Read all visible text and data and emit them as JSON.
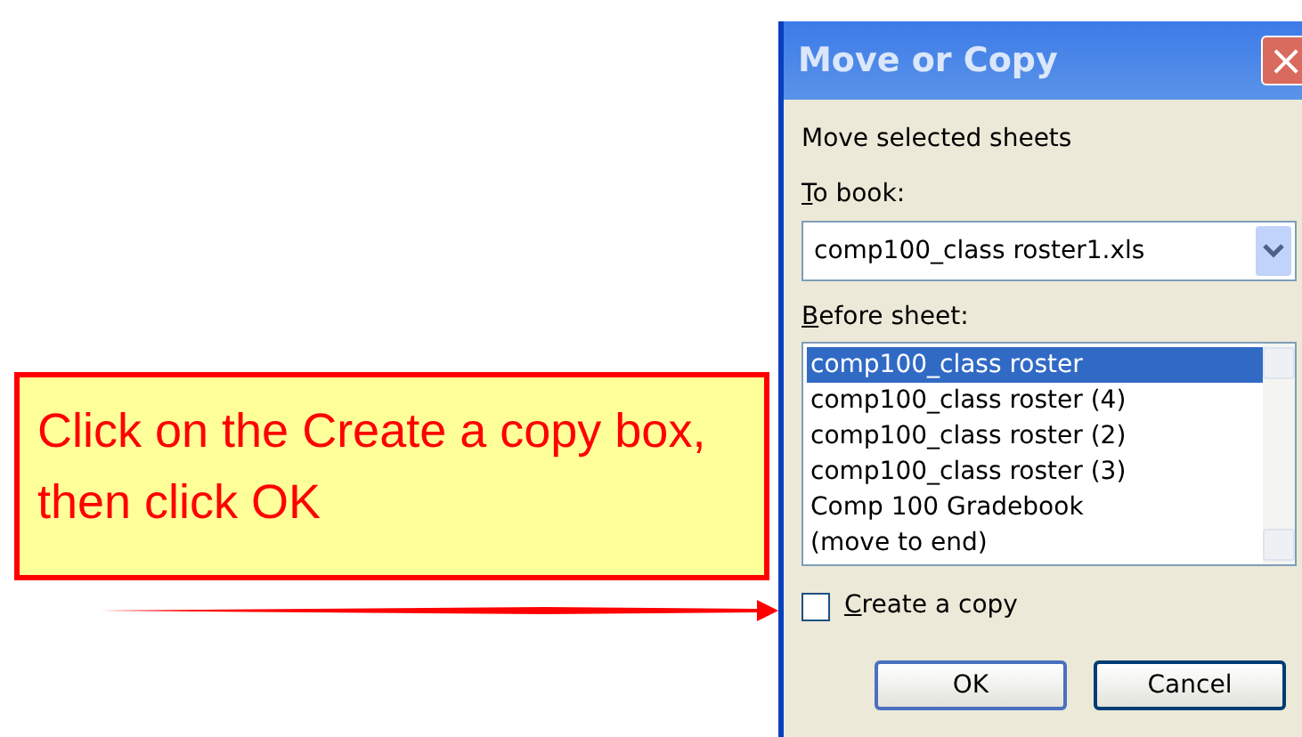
{
  "callout": {
    "text": "Click on the Create a copy box, then click OK"
  },
  "dialog": {
    "title": "Move or Copy",
    "close": "×",
    "intro": "Move selected sheets",
    "to_book_label": "To book:",
    "to_book_value": "comp100_class roster1.xls",
    "before_sheet_label": "Before sheet:",
    "sheets": [
      {
        "label": "comp100_class roster",
        "selected": true
      },
      {
        "label": "comp100_class roster (4)",
        "selected": false
      },
      {
        "label": "comp100_class roster (2)",
        "selected": false
      },
      {
        "label": "comp100_class roster (3)",
        "selected": false
      },
      {
        "label": "Comp 100 Gradebook",
        "selected": false
      },
      {
        "label": "(move to end)",
        "selected": false
      }
    ],
    "create_copy": {
      "label": "Create a copy",
      "checked": false
    },
    "buttons": [
      "OK",
      "Cancel"
    ]
  }
}
